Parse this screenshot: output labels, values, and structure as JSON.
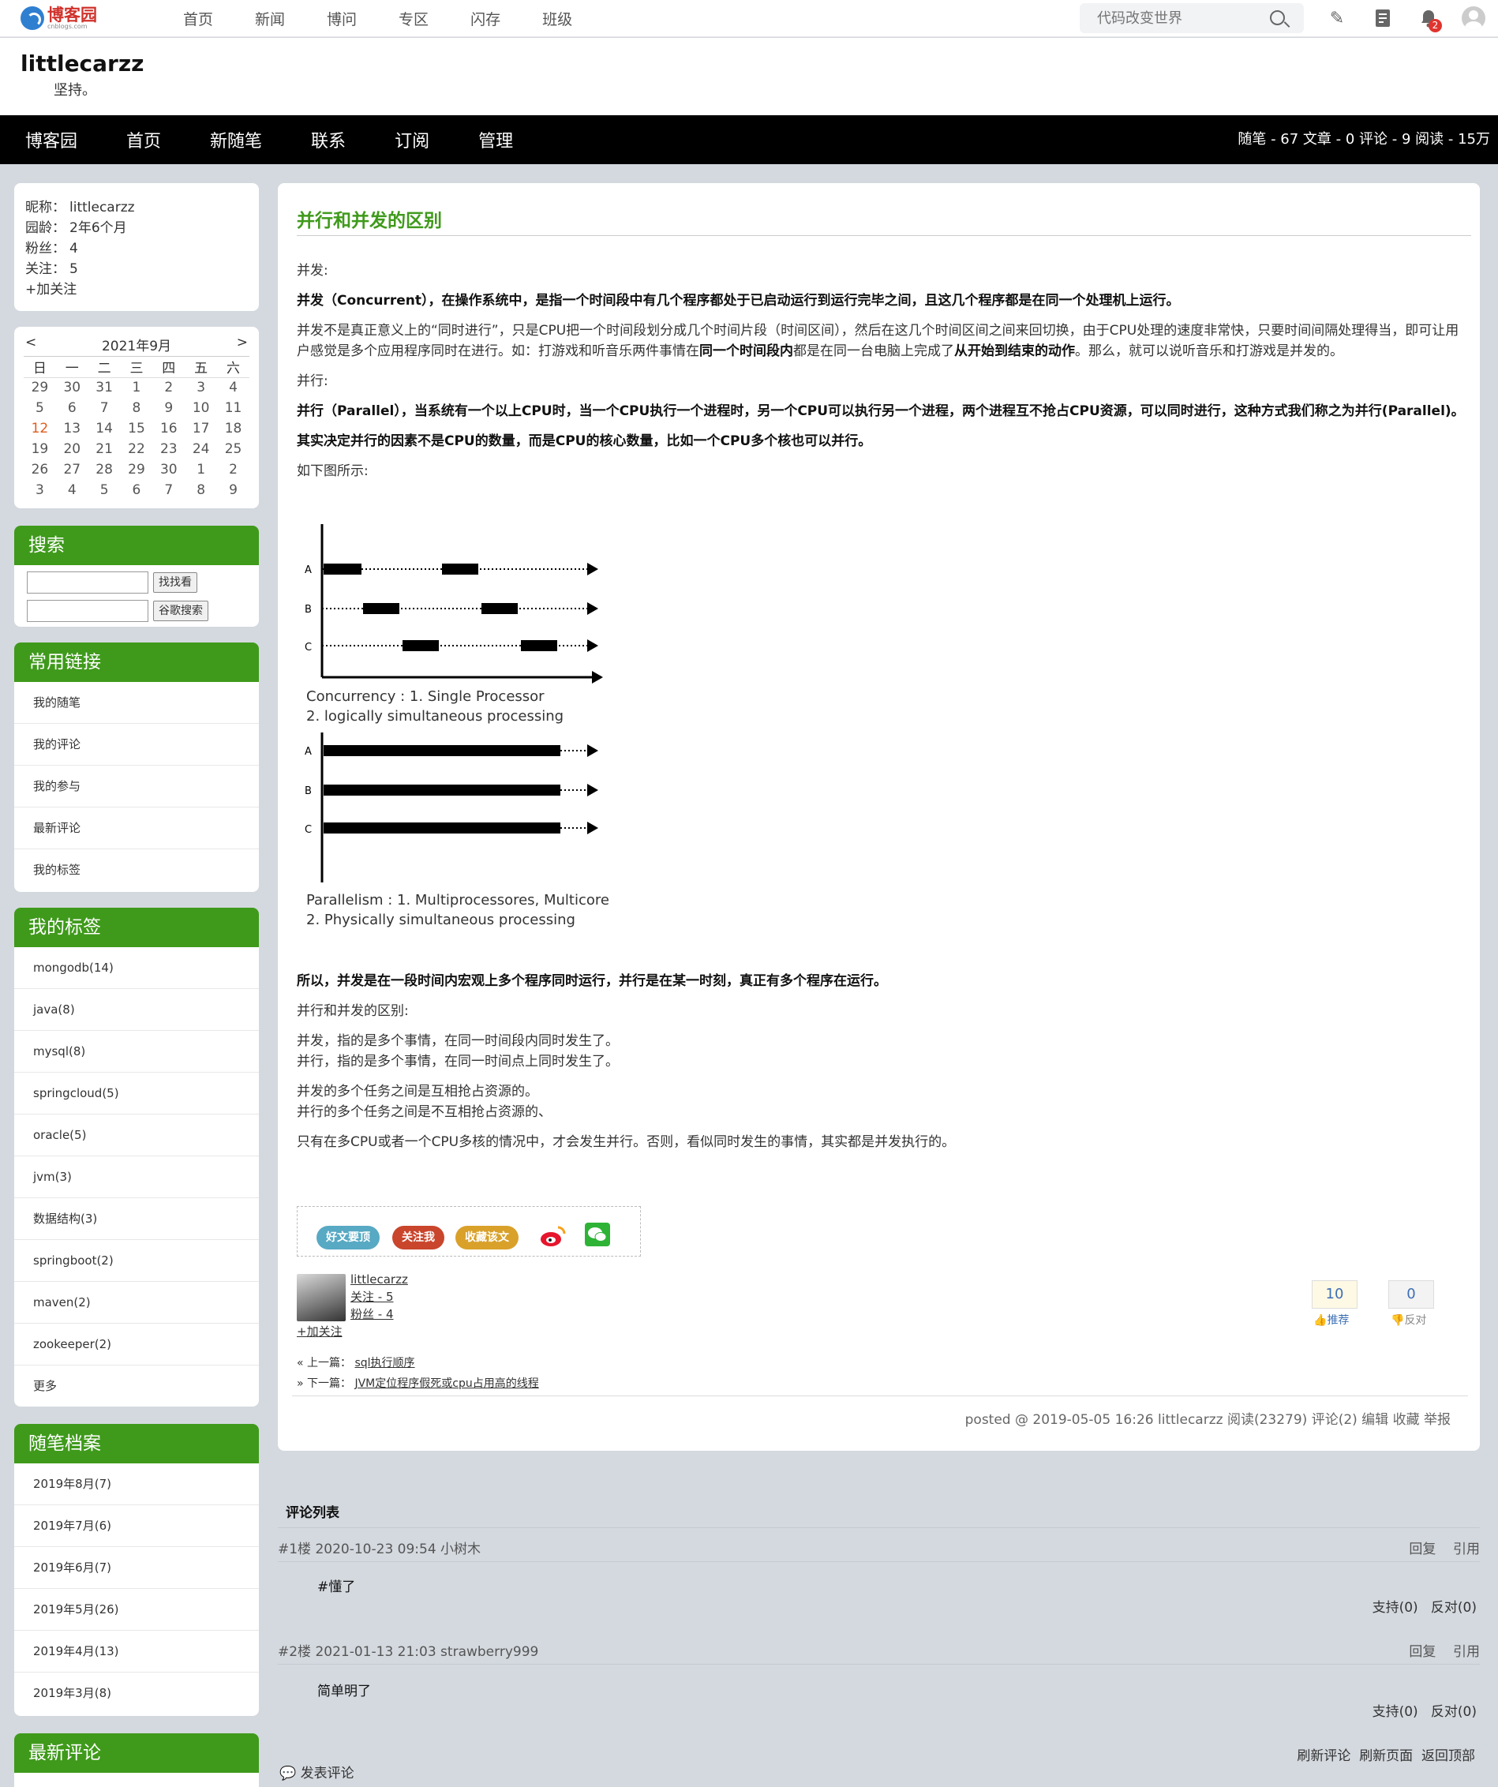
{
  "topbar": {
    "logo_text": "博客园",
    "logo_sub": "cnblogs.com",
    "nav": [
      "首页",
      "新闻",
      "博问",
      "专区",
      "闪存",
      "班级"
    ],
    "search_placeholder": "代码改变世界",
    "notification_count": "2"
  },
  "header": {
    "title": "littlecarzz",
    "subtitle": "坚持。"
  },
  "navbar": {
    "links": [
      "博客园",
      "首页",
      "新随笔",
      "联系",
      "订阅",
      "管理"
    ],
    "stats": "随笔 - 67  文章 - 0  评论 - 9  阅读 - 15万"
  },
  "profile": {
    "nickname_label": "昵称：",
    "nickname": "littlecarzz",
    "age_label": "园龄：",
    "age": "2年6个月",
    "fans_label": "粉丝：",
    "fans": "4",
    "follow_label": "关注：",
    "follow": "5",
    "add_follow": "+加关注"
  },
  "calendar": {
    "prev": "<",
    "title": "2021年9月",
    "next": ">",
    "weekdays": [
      "日",
      "一",
      "二",
      "三",
      "四",
      "五",
      "六"
    ],
    "weeks": [
      [
        "29",
        "30",
        "31",
        "1",
        "2",
        "3",
        "4"
      ],
      [
        "5",
        "6",
        "7",
        "8",
        "9",
        "10",
        "11"
      ],
      [
        "12",
        "13",
        "14",
        "15",
        "16",
        "17",
        "18"
      ],
      [
        "19",
        "20",
        "21",
        "22",
        "23",
        "24",
        "25"
      ],
      [
        "26",
        "27",
        "28",
        "29",
        "30",
        "1",
        "2"
      ],
      [
        "3",
        "4",
        "5",
        "6",
        "7",
        "8",
        "9"
      ]
    ],
    "today": "12"
  },
  "search": {
    "title": "搜索",
    "btn1": "找找看",
    "btn2": "谷歌搜索"
  },
  "links": {
    "title": "常用链接",
    "items": [
      "我的随笔",
      "我的评论",
      "我的参与",
      "最新评论",
      "我的标签"
    ]
  },
  "tags": {
    "title": "我的标签",
    "items": [
      "mongodb(14)",
      "java(8)",
      "mysql(8)",
      "springcloud(5)",
      "oracle(5)",
      "jvm(3)",
      "数据结构(3)",
      "springboot(2)",
      "maven(2)",
      "zookeeper(2)",
      "更多"
    ]
  },
  "archive": {
    "title": "随笔档案",
    "items": [
      "2019年8月(7)",
      "2019年7月(6)",
      "2019年6月(7)",
      "2019年5月(26)",
      "2019年4月(13)",
      "2019年3月(8)"
    ]
  },
  "recent": {
    "title": "最新评论"
  },
  "post": {
    "title": "并行和并发的区别",
    "p_concurrent_label": "并发:",
    "p_concurrent_def": "并发（Concurrent），在操作系统中，是指一个时间段中有几个程序都处于已启动运行到运行完毕之间，且这几个程序都是在同一个处理机上运行。",
    "p_concurrent_desc_1": "并发不是真正意义上的“同时进行”，只是CPU把一个时间段划分成几个时间片段（时间区间），然后在这几个时间区间之间来回切换，由于CPU处理的速度非常快，只要时间间隔处理得当，即可让用户感觉是多个应用程序同时在进行。如：打游戏和听音乐两件事情在",
    "p_concurrent_desc_b1": "同一个时间段内",
    "p_concurrent_desc_2": "都是在同一台电脑上完成了",
    "p_concurrent_desc_b2": "从开始到结束的动作",
    "p_concurrent_desc_3": "。那么，就可以说听音乐和打游戏是并发的。",
    "p_parallel_label": "并行:",
    "p_parallel_def": "并行（Parallel），当系统有一个以上CPU时，当一个CPU执行一个进程时，另一个CPU可以执行另一个进程，两个进程互不抢占CPU资源，可以同时进行，这种方式我们称之为并行(Parallel)。",
    "p_parallel_factor": "其实决定并行的因素不是CPU的数量，而是CPU的核心数量，比如一个CPU多个核也可以并行。",
    "p_figure_intro": "如下图所示:",
    "diagram1_caption_1": "Concurrency : 1. Single Processor",
    "diagram1_caption_2": "2. logically simultaneous processing",
    "diagram2_caption_1": "Parallelism : 1. Multiprocessores, Multicore",
    "diagram2_caption_2": "2. Physically simultaneous processing",
    "diagram_rows": [
      "A",
      "B",
      "C"
    ],
    "p_summary": "所以，并发是在一段时间内宏观上多个程序同时运行，并行是在某一时刻，真正有多个程序在运行。",
    "p_diff_label": "并行和并发的区别:",
    "p_diff_1": "并发，指的是多个事情，在同一时间段内同时发生了。",
    "p_diff_2": "并行，指的是多个事情，在同一时间点上同时发生了。",
    "p_diff_3": "并发的多个任务之间是互相抢占资源的。",
    "p_diff_4": "并行的多个任务之间是不互相抢占资源的、",
    "p_diff_5": "只有在多CPU或者一个CPU多核的情况中，才会发生并行。否则，看似同时发生的事情，其实都是并发执行的。",
    "btn_recommend": "好文要顶",
    "btn_follow": "关注我",
    "btn_collect": "收藏该文",
    "author_name": "littlecarzz",
    "author_follow": "关注 - 5",
    "author_fans": "粉丝 - 4",
    "author_add": "+加关注",
    "digg_count": "10",
    "digg_label": "推荐",
    "bury_count": "0",
    "bury_label": "反对",
    "prev_label": "« 上一篇：",
    "prev_title": "sql执行顺序",
    "next_label": "» 下一篇：",
    "next_title": "JVM定位程序假死或cpu占用高的线程",
    "footer": "posted @ 2019-05-05 16:26  littlecarzz  阅读(23279)  评论(2)  编辑  收藏  举报"
  },
  "comments": {
    "title": "评论列表",
    "items": [
      {
        "meta": "#1楼 2020-10-23 09:54 小树木",
        "text": "#懂了",
        "support": "支持(0)",
        "oppose": "反对(0)"
      },
      {
        "meta": "#2楼 2021-01-13 21:03 strawberry999",
        "text": "简单明了",
        "support": "支持(0)",
        "oppose": "反对(0)"
      }
    ],
    "reply": "回复",
    "quote": "引用",
    "refresh_comments": "刷新评论",
    "refresh_page": "刷新页面",
    "back_top": "返回顶部",
    "post_comment": "发表评论"
  },
  "colors": {
    "accent_green": "#3f9a1b",
    "navbar_bg": "#000000",
    "page_bg": "#d4d9df"
  }
}
